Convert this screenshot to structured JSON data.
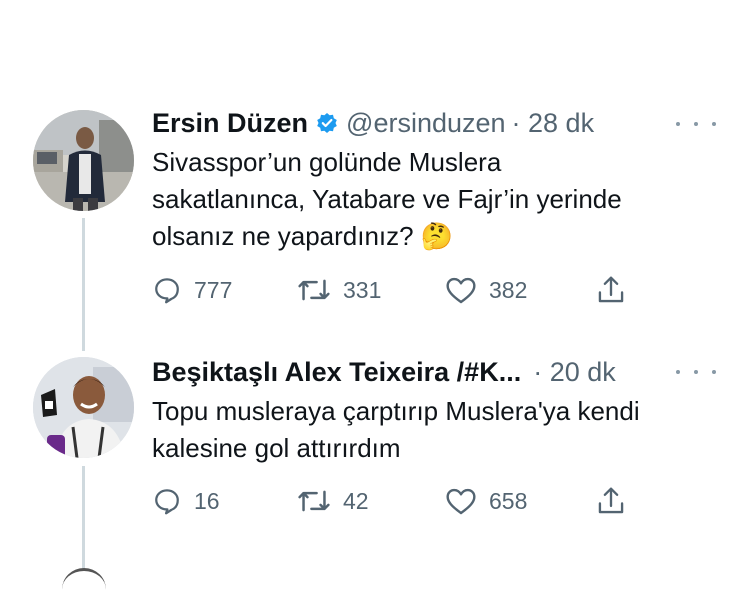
{
  "tweets": [
    {
      "display_name": "Ersin Düzen",
      "handle": "@ersinduzen",
      "time": "· 28 dk",
      "lines": [
        "Sivasspor’un golünde Muslera",
        "sakatlanınca, Yatabare ve Fajr’in yerinde",
        "olsanız ne yapardınız?"
      ],
      "emoji": "🤔",
      "replies": "777",
      "retweets": "331",
      "likes": "382"
    },
    {
      "display_name": "Beşiktaşlı Alex Teixeira /#K...",
      "time": "· 20 dk",
      "lines": [
        "Topu musleraya çarptırıp Muslera'ya kendi",
        "kalesine gol attırırdım"
      ],
      "replies": "16",
      "retweets": "42",
      "likes": "658"
    }
  ],
  "colors": {
    "text": "#0f1419",
    "muted": "#536471",
    "verified": "#1d9bf0",
    "thread_line": "#cfd9de"
  }
}
